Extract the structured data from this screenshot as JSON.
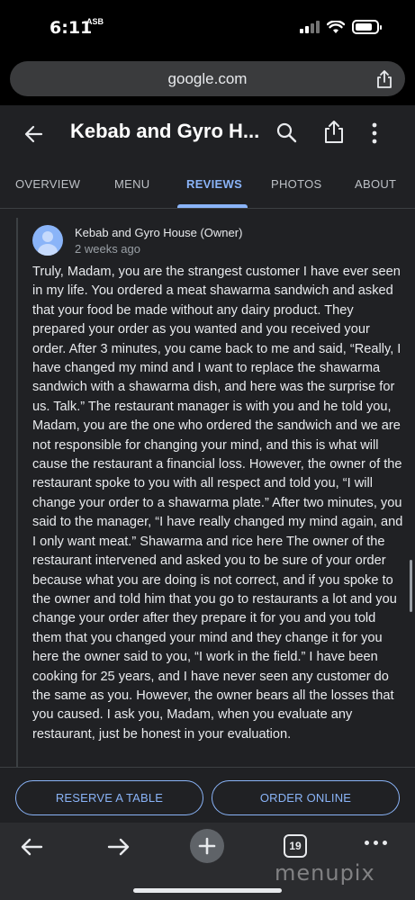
{
  "status_bar": {
    "time": "6:11",
    "time_badge": "ASB"
  },
  "browser": {
    "url": "google.com"
  },
  "appbar": {
    "title": "Kebab and Gyro H..."
  },
  "tabs": [
    {
      "label": "OVERVIEW",
      "active": false
    },
    {
      "label": "MENU",
      "active": false
    },
    {
      "label": "REVIEWS",
      "active": true
    },
    {
      "label": "PHOTOS",
      "active": false
    },
    {
      "label": "ABOUT",
      "active": false
    }
  ],
  "reply": {
    "author": "Kebab and Gyro House (Owner)",
    "date": "2 weeks ago",
    "text": "Truly, Madam, you are the strangest customer I have ever seen in my life. You ordered a meat shawarma sandwich and asked that your food be made without any dairy product. They prepared your order as you wanted and you received your order. After 3 minutes, you came back to me and said, “Really, I have changed my mind and I want to replace the shawarma sandwich with a shawarma dish, and here was the surprise for us. Talk.” The restaurant manager is with you and he told you, Madam, you are the one who ordered the sandwich and we are not responsible for changing your mind, and this is what will cause the restaurant a financial loss. However, the owner of the restaurant spoke to you with all respect and told you, “I will change your order to a shawarma plate.” After two minutes, you said to the manager, “I have really changed my mind again, and I only want meat.” Shawarma and rice here The owner of the restaurant intervened and asked you to be sure of your order because what you are doing is not correct, and if you spoke to the owner and told him that you go to restaurants a lot and you change your order after they prepare it for you and you told them that you changed your mind and they change it for you here the owner said to you, “I work in the field.” I have been cooking for 25 years, and I have never seen any customer do the same as you. However, the owner bears all the losses that you caused. I ask you, Madam, when you evaluate any restaurant, just be honest in your evaluation."
  },
  "actions": {
    "reserve": "RESERVE A TABLE",
    "order": "ORDER ONLINE"
  },
  "toolbar": {
    "tab_count": "19"
  },
  "watermark": "menupix",
  "colors": {
    "accent": "#8ab4f8",
    "surface": "#202124",
    "background": "#000000"
  }
}
